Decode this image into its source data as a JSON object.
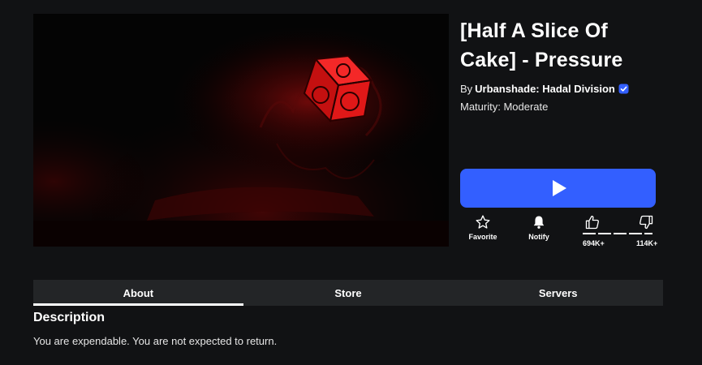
{
  "game": {
    "title": "[Half A Slice Of Cake] - Pressure",
    "creator_prefix": "By",
    "creator_name": "Urbanshade: Hadal Division",
    "maturity": "Maturity: Moderate",
    "thumbnail_icon": "glowing-red-cube-artwork"
  },
  "actions": {
    "favorite_label": "Favorite",
    "notify_label": "Notify",
    "likes": "694K+",
    "dislikes": "114K+"
  },
  "tabs": [
    {
      "label": "About",
      "active": true
    },
    {
      "label": "Store",
      "active": false
    },
    {
      "label": "Servers",
      "active": false
    }
  ],
  "description": {
    "heading": "Description",
    "text": "You are expendable. You are not expected to return."
  },
  "colors": {
    "background": "#111214",
    "play_button": "#335fff",
    "tab_bar": "#232527",
    "verified_badge": "#335fff",
    "accent_red": "#ff1a1a"
  }
}
